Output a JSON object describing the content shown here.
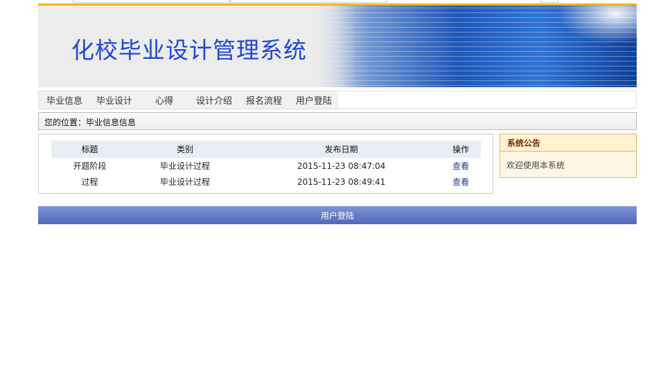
{
  "banner": {
    "title": "化校毕业设计管理系统"
  },
  "nav": {
    "items": [
      {
        "label": "毕业信息"
      },
      {
        "label": "毕业设计"
      },
      {
        "label": "心得"
      },
      {
        "label": "设计介绍"
      },
      {
        "label": "报名流程"
      },
      {
        "label": "用户登陆"
      }
    ]
  },
  "breadcrumb": {
    "text": "您的位置：毕业信息信息"
  },
  "table": {
    "headers": [
      "标题",
      "类别",
      "发布日期",
      "操作"
    ],
    "rows": [
      {
        "title": "开题阶段",
        "category": "毕业设计过程",
        "date": "2015-11-23 08:47:04",
        "action": "查看"
      },
      {
        "title": "过程",
        "category": "毕业设计过程",
        "date": "2015-11-23 08:49:41",
        "action": "查看"
      }
    ]
  },
  "notice": {
    "title": "系统公告",
    "body": "欢迎使用本系统"
  },
  "footer": {
    "label": "用户登陆"
  },
  "colors": {
    "accent": "#f3b400",
    "title": "#1e47d6",
    "footer": "#5a72c0"
  }
}
